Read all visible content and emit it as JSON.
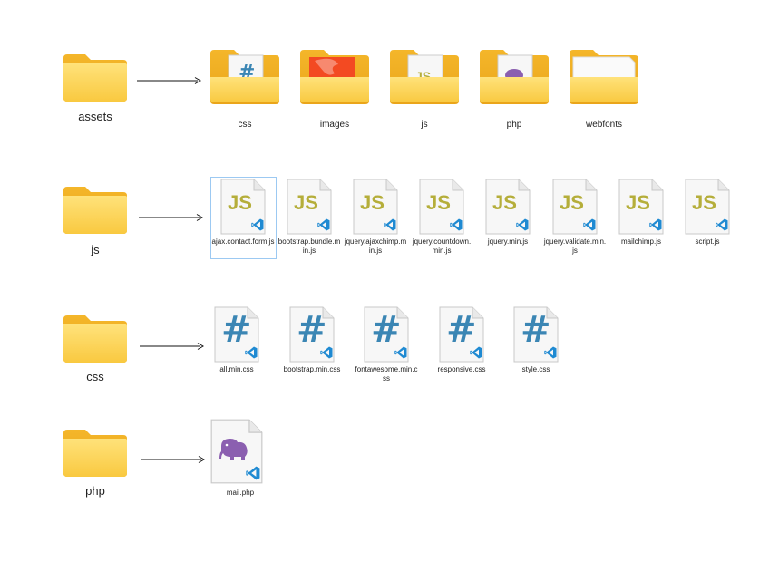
{
  "rows": [
    {
      "folder": "assets",
      "items": [
        "css",
        "images",
        "js",
        "php",
        "webfonts"
      ]
    },
    {
      "folder": "js",
      "files": [
        "ajax.contact.form.js",
        "bootstrap.bundle.min.js",
        "jquery.ajaxchimp.min.js",
        "jquery.countdown.min.js",
        "jquery.min.js",
        "jquery.validate.min.js",
        "mailchimp.js",
        "script.js"
      ]
    },
    {
      "folder": "css",
      "files": [
        "all.min.css",
        "bootstrap.min.css",
        "fontawesome.min.css",
        "responsive.css",
        "style.css"
      ]
    },
    {
      "folder": "php",
      "files": [
        "mail.php"
      ]
    }
  ],
  "icons": {
    "js_glyph": "JS",
    "css_glyph": "#",
    "folder_color": "#f6c744",
    "js_color": "#b5ae3a",
    "css_color": "#3b86b4",
    "php_color": "#8b5fb0",
    "vscode_color": "#1f8ad2"
  }
}
